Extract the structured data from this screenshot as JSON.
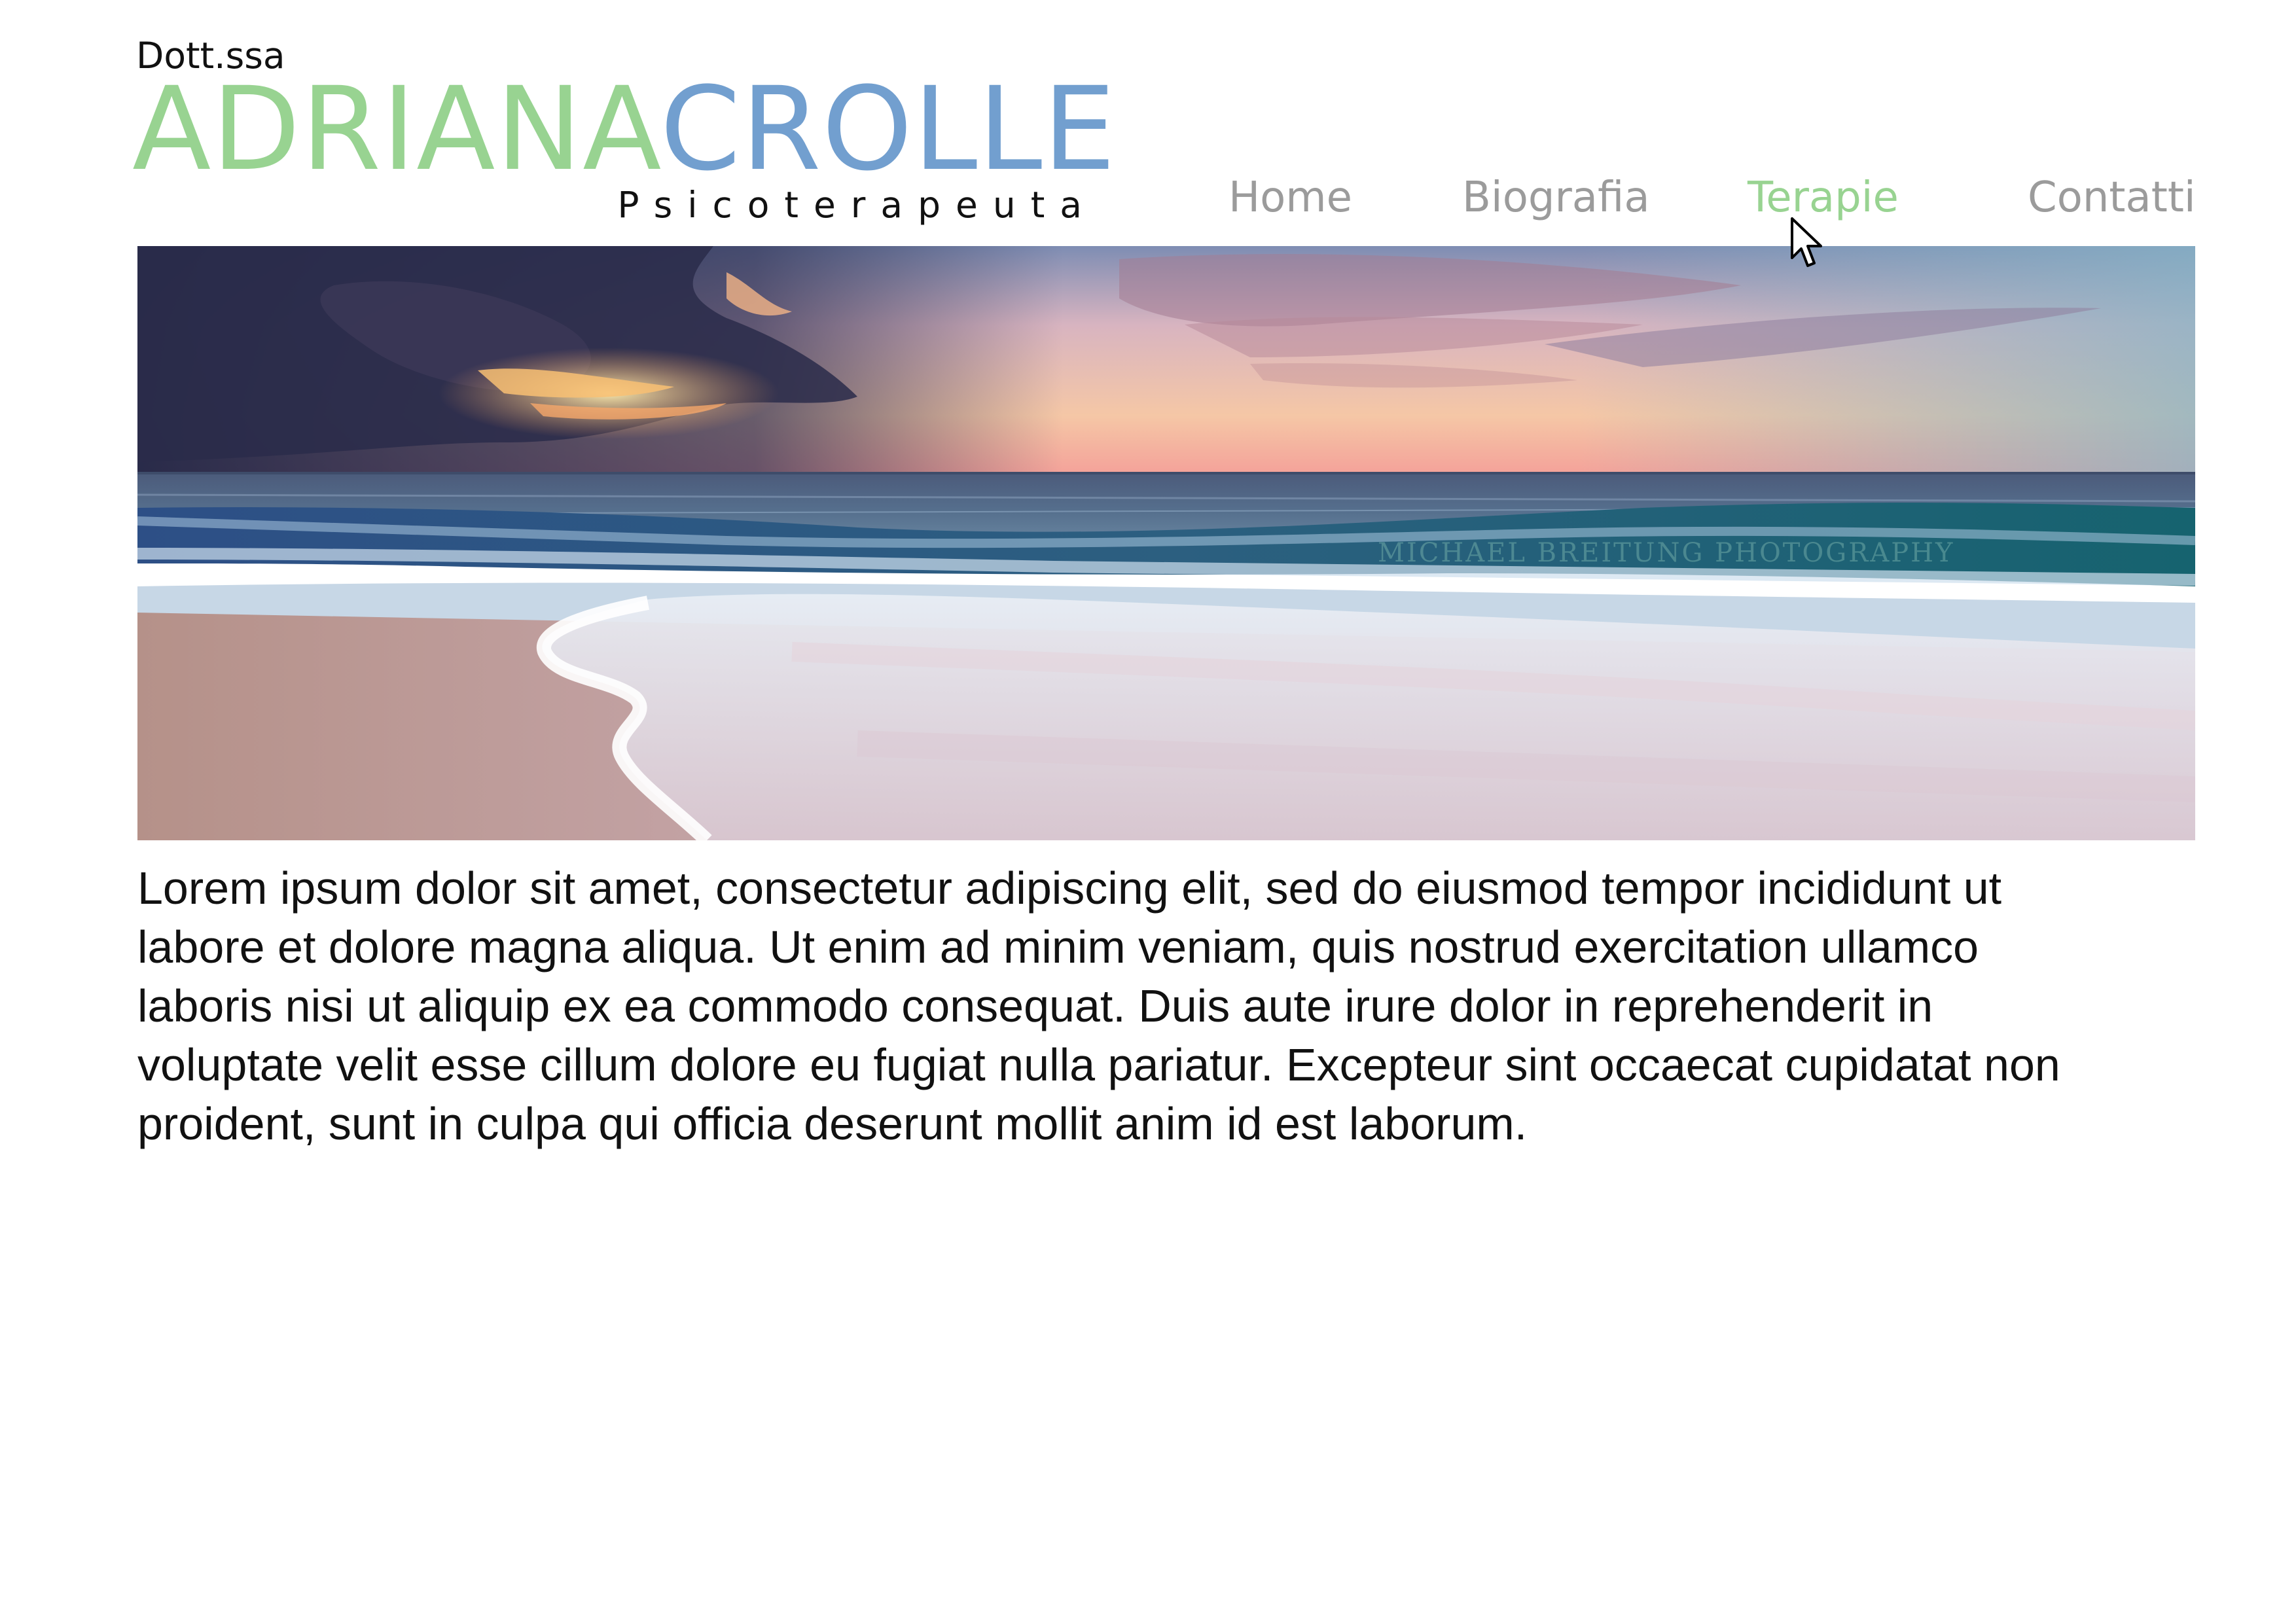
{
  "colors": {
    "green": "#98d391",
    "blue": "#729fcf",
    "nav_default": "#9b9b9b",
    "text": "#111111"
  },
  "logo": {
    "prefix": "Dott.ssa",
    "first_name": "ADRIANA",
    "last_name": "CROLLE",
    "subtitle": "Psicoterapeuta"
  },
  "nav": {
    "active": "Terapie",
    "items": [
      {
        "label": "Home"
      },
      {
        "label": "Biografia"
      },
      {
        "label": "Terapie"
      },
      {
        "label": "Contatti"
      }
    ]
  },
  "hero": {
    "description": "sunset-beach-photo",
    "watermark": "MICHAEL BREITUNG PHOTOGRAPHY"
  },
  "content": {
    "paragraph": "Lorem ipsum dolor sit amet, consectetur adipiscing elit, sed do eiusmod tempor incididunt ut labore et dolore magna aliqua. Ut enim ad minim veniam, quis nostrud exercitation ullamco laboris nisi ut aliquip ex ea commodo consequat. Duis aute irure dolor in reprehenderit in voluptate velit esse cillum dolore eu fugiat nulla pariatur. Excepteur sint occaecat cupidatat non proident, sunt in culpa qui officia deserunt mollit anim id est laborum."
  },
  "cursor": {
    "icon": "arrow-cursor-icon"
  }
}
